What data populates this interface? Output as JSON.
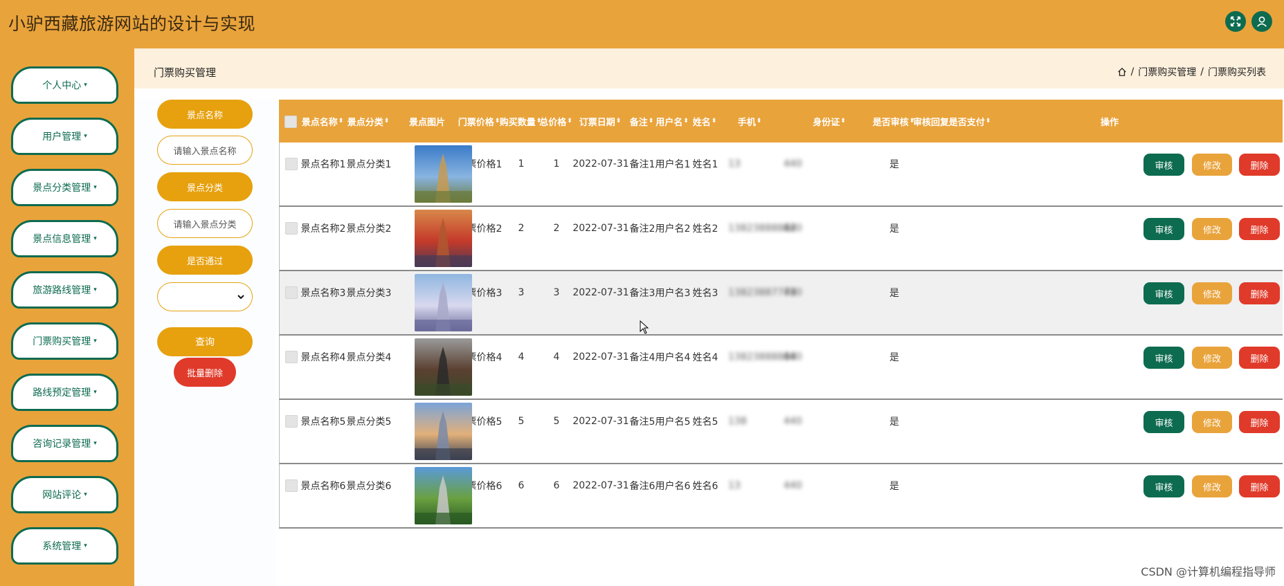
{
  "app": {
    "title": "小驴西藏旅游网站的设计与实现"
  },
  "header": {
    "fullscreen_icon": "expand-arrows-icon",
    "user_icon": "user-icon"
  },
  "sidebar": {
    "items": [
      {
        "label": "个人中心"
      },
      {
        "label": "用户管理"
      },
      {
        "label": "景点分类管理"
      },
      {
        "label": "景点信息管理"
      },
      {
        "label": "旅游路线管理"
      },
      {
        "label": "门票购买管理"
      },
      {
        "label": "路线预定管理"
      },
      {
        "label": "咨询记录管理"
      },
      {
        "label": "网站评论"
      },
      {
        "label": "系统管理"
      }
    ],
    "caret": "▾"
  },
  "page": {
    "title": "门票购买管理",
    "breadcrumb": [
      "门票购买管理",
      "门票购买列表"
    ],
    "breadcrumb_sep": "/"
  },
  "filters": {
    "name_label": "景点名称",
    "name_placeholder": "请输入景点名称",
    "category_label": "景点分类",
    "category_placeholder": "请输入景点分类",
    "passed_label": "是否通过",
    "passed_value": "",
    "search_label": "查询",
    "batch_delete_label": "批量删除"
  },
  "table": {
    "columns": [
      {
        "label": "景点名称",
        "sortable": true
      },
      {
        "label": "景点分类",
        "sortable": true
      },
      {
        "label": "景点图片",
        "sortable": false
      },
      {
        "label": "门票价格",
        "sortable": true
      },
      {
        "label": "购买数量",
        "sortable": true
      },
      {
        "label": "总价格",
        "sortable": true
      },
      {
        "label": "订票日期",
        "sortable": true
      },
      {
        "label": "备注",
        "sortable": true
      },
      {
        "label": "用户名",
        "sortable": true
      },
      {
        "label": "姓名",
        "sortable": true
      },
      {
        "label": "手机",
        "sortable": true
      },
      {
        "label": "身份证",
        "sortable": true
      },
      {
        "label": "是否审核",
        "sortable": true
      },
      {
        "label": "审核回复",
        "sortable": false
      },
      {
        "label": "是否支付",
        "sortable": true
      },
      {
        "label": "操作",
        "sortable": false
      }
    ],
    "sort_glyph": "⬍",
    "rows": [
      {
        "name": "景点名称1",
        "category": "景点分类1",
        "price": "门票价格1",
        "qty": "1",
        "total": "1",
        "date": "2022-07-31",
        "note": "备注1",
        "username": "用户名1",
        "realname": "姓名1",
        "phone": "13",
        "idcard": "440",
        "audited": "是",
        "img_theme": "temple"
      },
      {
        "name": "景点名称2",
        "category": "景点分类2",
        "price": "门票价格2",
        "qty": "2",
        "total": "2",
        "date": "2022-07-31",
        "note": "备注2",
        "username": "用户名2",
        "realname": "姓名2",
        "phone": "13823888882",
        "idcard": "440",
        "audited": "是",
        "img_theme": "palace"
      },
      {
        "name": "景点名称3",
        "category": "景点分类3",
        "price": "门票价格3",
        "qty": "3",
        "total": "3",
        "date": "2022-07-31",
        "note": "备注3",
        "username": "用户名3",
        "realname": "姓名3",
        "phone": "13823887773",
        "idcard": "440",
        "audited": "是",
        "img_theme": "castle"
      },
      {
        "name": "景点名称4",
        "category": "景点分类4",
        "price": "门票价格4",
        "qty": "4",
        "total": "4",
        "date": "2022-07-31",
        "note": "备注4",
        "username": "用户名4",
        "realname": "姓名4",
        "phone": "13823888884",
        "idcard": "440",
        "audited": "是",
        "img_theme": "pavilion"
      },
      {
        "name": "景点名称5",
        "category": "景点分类5",
        "price": "门票价格5",
        "qty": "5",
        "total": "5",
        "date": "2022-07-31",
        "note": "备注5",
        "username": "用户名5",
        "realname": "姓名5",
        "phone": "138",
        "idcard": "440",
        "audited": "是",
        "img_theme": "tower"
      },
      {
        "name": "景点名称6",
        "category": "景点分类6",
        "price": "门票价格6",
        "qty": "6",
        "total": "6",
        "date": "2022-07-31",
        "note": "备注6",
        "username": "用户名6",
        "realname": "姓名6",
        "phone": "13",
        "idcard": "440",
        "audited": "是",
        "img_theme": "mountain"
      }
    ],
    "actions": {
      "audit": "审核",
      "edit": "修改",
      "delete": "删除"
    }
  },
  "watermark": "CSDN @计算机编程指导师",
  "colors": {
    "primary_orange": "#e9a33b",
    "dark_green": "#0d6b4f",
    "danger_red": "#e03a2a",
    "pill_orange": "#e7a10f"
  }
}
